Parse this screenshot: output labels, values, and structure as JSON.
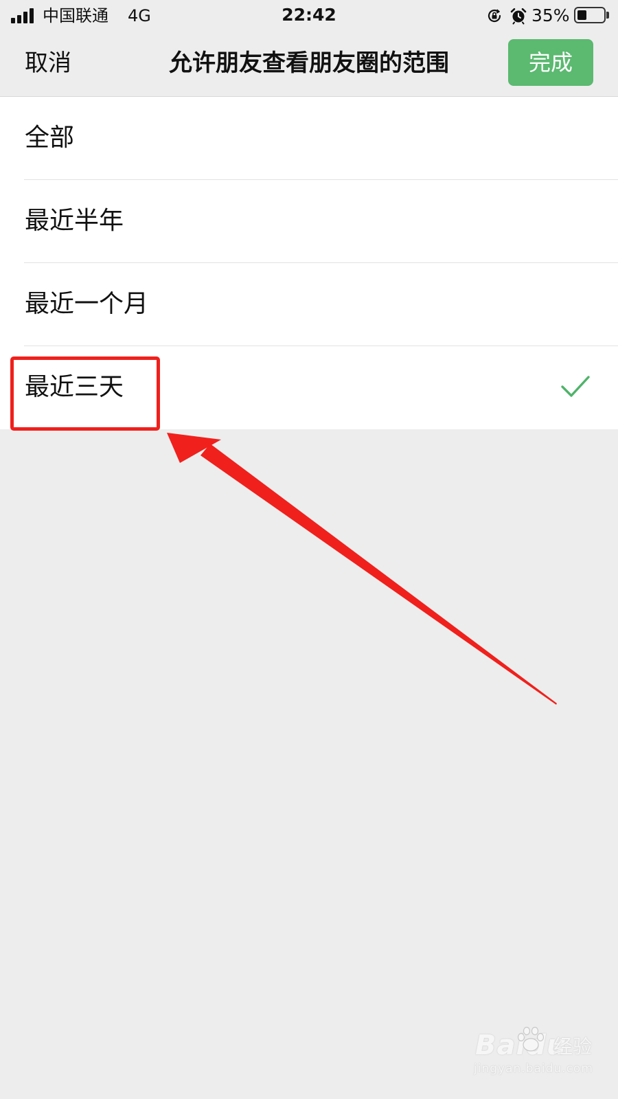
{
  "status_bar": {
    "carrier": "中国联通",
    "network": "4G",
    "time": "22:42",
    "battery_percent": "35%",
    "battery_level": 0.35,
    "signal_bars": 4,
    "icons": [
      "signal-icon",
      "orientation-lock-icon",
      "alarm-icon",
      "battery-icon"
    ]
  },
  "nav": {
    "cancel_label": "取消",
    "title": "允许朋友查看朋友圈的范围",
    "done_label": "完成"
  },
  "options": [
    {
      "label": "全部",
      "selected": false
    },
    {
      "label": "最近半年",
      "selected": false
    },
    {
      "label": "最近一个月",
      "selected": false
    },
    {
      "label": "最近三天",
      "selected": true
    }
  ],
  "annotation": {
    "highlight_color": "#f0201c",
    "arrow_color": "#f0201c",
    "target": "最近三天"
  },
  "watermark": {
    "logo": "Baidu",
    "label": "经验",
    "url": "jingyan.baidu.com"
  },
  "colors": {
    "accent_green": "#5bb970",
    "check_green": "#4fb36a",
    "background": "#ededed",
    "list_background": "#ffffff"
  }
}
